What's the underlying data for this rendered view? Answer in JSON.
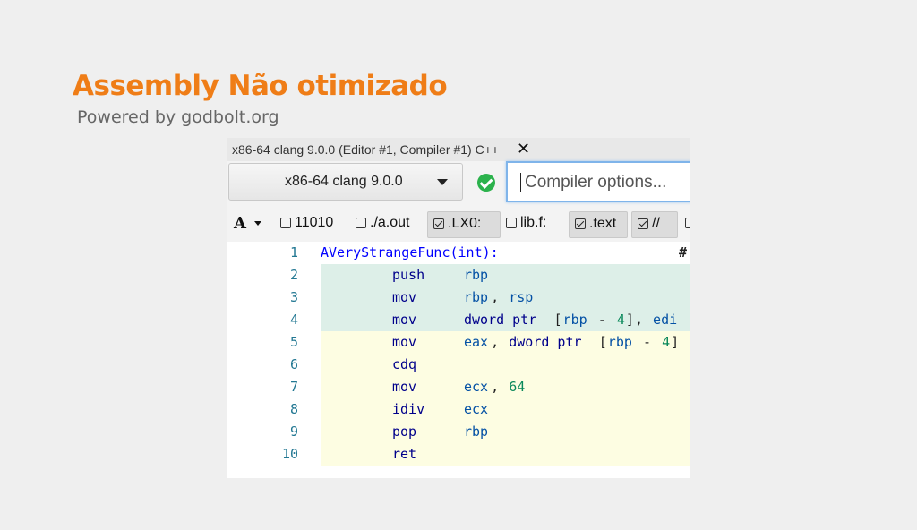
{
  "slide": {
    "title": "Assembly Não otimizado",
    "subtitle": "Powered by godbolt.org"
  },
  "panel": {
    "tab_title": "x86-64 clang 9.0.0 (Editor #1, Compiler #1) C++",
    "tab_close": "✕",
    "compiler": "x86-64 clang 9.0.0",
    "options_placeholder": "Compiler options...",
    "font_button": "A",
    "filters": [
      {
        "label": "11010",
        "checked": false
      },
      {
        "label": "./a.out",
        "checked": false
      },
      {
        "label": ".LX0:",
        "checked": true
      },
      {
        "label": "lib.f:",
        "checked": false
      },
      {
        "label": ".text",
        "checked": true
      },
      {
        "label": "//",
        "checked": true
      }
    ]
  },
  "code": {
    "lines": [
      {
        "n": "1",
        "label": "AVeryStrangeFunc(int):",
        "comment": "#"
      },
      {
        "n": "2",
        "op": "push",
        "a": [
          "rbp"
        ]
      },
      {
        "n": "3",
        "op": "mov",
        "a": [
          "rbp",
          ", ",
          "rsp"
        ]
      },
      {
        "n": "4",
        "op": "mov",
        "a": [
          "dword ptr ",
          "[",
          "rbp",
          " - ",
          "4",
          "]",
          ", ",
          "edi"
        ]
      },
      {
        "n": "5",
        "op": "mov",
        "a": [
          "eax",
          ", ",
          "dword ptr ",
          "[",
          "rbp",
          " - ",
          "4",
          "]"
        ]
      },
      {
        "n": "6",
        "op": "cdq"
      },
      {
        "n": "7",
        "op": "mov",
        "a": [
          "ecx",
          ", ",
          "64"
        ]
      },
      {
        "n": "8",
        "op": "idiv",
        "a": [
          "ecx"
        ]
      },
      {
        "n": "9",
        "op": "pop",
        "a": [
          "rbp"
        ]
      },
      {
        "n": "10",
        "op": "ret"
      }
    ]
  }
}
